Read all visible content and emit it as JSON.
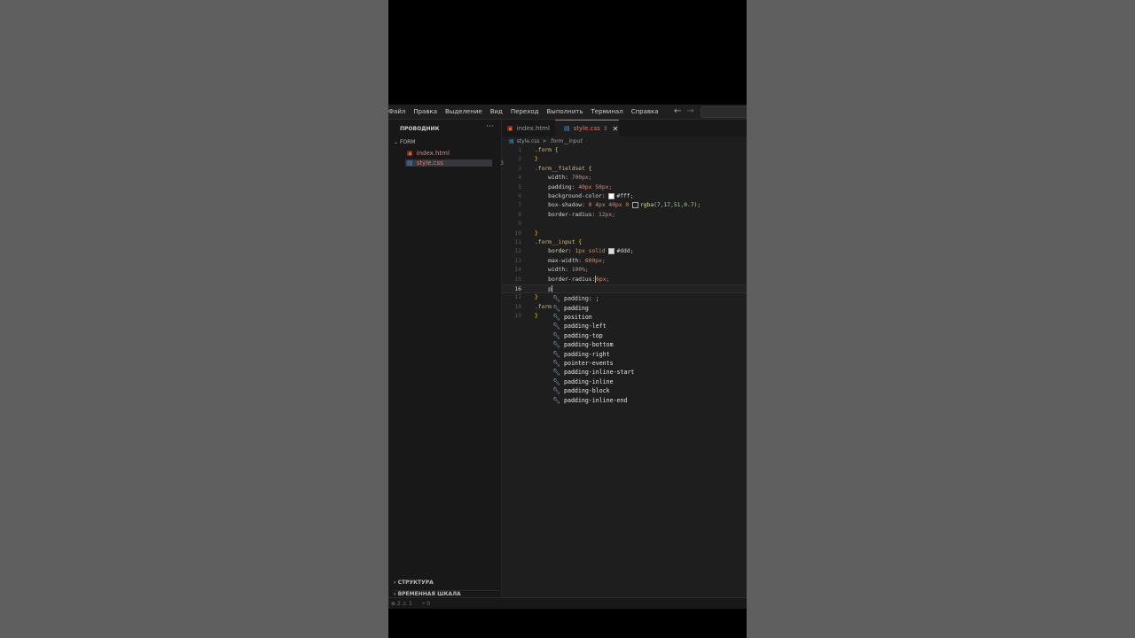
{
  "menu": [
    "Файл",
    "Правка",
    "Выделение",
    "Вид",
    "Переход",
    "Выполнить",
    "Терминал",
    "Справка"
  ],
  "nav": {
    "back": "←",
    "forward": "→"
  },
  "explorer": {
    "title": "ПРОВОДНИК",
    "more": "···",
    "folder": "FORM",
    "files": [
      {
        "name": "index.html"
      },
      {
        "name": "style.css",
        "badge": "3"
      }
    ],
    "sections": [
      "СТРУКТУРА",
      "ВРЕМЕННАЯ ШКАЛА"
    ]
  },
  "tabs": [
    {
      "name": "index.html"
    },
    {
      "name": "style.css",
      "count": "3",
      "close": "✕"
    }
  ],
  "breadcrumb": {
    "file": "style.css",
    "sep": ">",
    "symbol": ".form__input"
  },
  "code": {
    "line_numbers": [
      "1",
      "2",
      "3",
      "4",
      "5",
      "6",
      "7",
      "8",
      "9",
      "10",
      "11",
      "12",
      "13",
      "14",
      "15",
      "16",
      "17",
      "18",
      "19"
    ],
    "l1_sel": ".form",
    "l1_brace": "{",
    "l2": "}",
    "l3_sel": ".form__fieldset",
    "l3_brace": "{",
    "l4_prop": "width:",
    "l4_val": "700px;",
    "l5_prop": "padding:",
    "l5_val": "40px 50px;",
    "l6_prop": "background-color:",
    "l6_val": "#fff;",
    "l7_prop": "box-shadow:",
    "l7_val": "0 4px 40px 0",
    "l7_fn": "rgba",
    "l7_args": "(7,17,51,0.7);",
    "l8_prop": "border-radius:",
    "l8_val": "12px;",
    "l10": "}",
    "l11_sel": ".form__input",
    "l11_brace": "{",
    "l12_prop": "border:",
    "l12_val": "1px solid",
    "l12_color": "#ddd;",
    "l13_prop": "max-width:",
    "l13_val": "600px;",
    "l14_prop": "width:",
    "l14_val": "100%;",
    "l15_prop": "border-radius:",
    "l15_val": "6px;",
    "l16_typed": "p",
    "l17": "}",
    "l18_sel": ".form",
    "l19": "}"
  },
  "suggestions": [
    "padding: ;",
    "padding",
    "position",
    "padding-left",
    "padding-top",
    "padding-bottom",
    "padding-right",
    "pointer-events",
    "padding-inline-start",
    "padding-inline",
    "padding-block",
    "padding-inline-end"
  ],
  "status": {
    "errors": "⊗ 2 ⚠ 1",
    "ports": "⑂ 0"
  },
  "colors": {
    "accent": "#3c9ee6",
    "css_file": "#e0786a",
    "html_icon": "#e45a35"
  }
}
